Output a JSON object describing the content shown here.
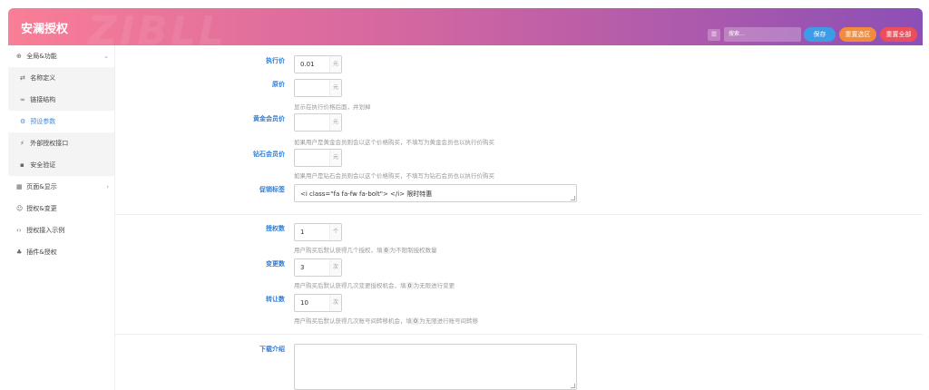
{
  "header": {
    "title": "安澜授权",
    "watermark": "ZIBLL",
    "menu_icon": "menu-icon",
    "search_placeholder": "搜索...",
    "save_label": "保存",
    "reset_section_label": "重置选区",
    "reset_all_label": "重置全部"
  },
  "sidebar": {
    "items": [
      {
        "label": "全局&功能",
        "icon": "globe-icon",
        "chevron": "⌄"
      },
      {
        "label": "页面&显示",
        "icon": "calendar-icon",
        "chevron": "›"
      },
      {
        "label": "授权&变更",
        "icon": "smile-icon"
      },
      {
        "label": "授权接入示例",
        "icon": "code-icon"
      },
      {
        "label": "插件&授权",
        "icon": "plug-icon"
      }
    ],
    "sub_items": [
      {
        "label": "名称定义",
        "icon": "retweet-icon"
      },
      {
        "label": "链接结构",
        "icon": "link-icon"
      },
      {
        "label": "预设参数",
        "icon": "cogs-icon"
      },
      {
        "label": "外部授权接口",
        "icon": "plug-icon"
      },
      {
        "label": "安全验证",
        "icon": "lock-icon"
      }
    ]
  },
  "form": {
    "exec_price": {
      "label": "执行价",
      "value": "0.01",
      "unit": "元"
    },
    "orig_price": {
      "label": "原价",
      "value": "",
      "unit": "元",
      "desc": "显示在执行价格后面，并划掉"
    },
    "gold_price": {
      "label": "黄金会员价",
      "value": "",
      "unit": "元",
      "desc": "如果用户是黄金会员则会以这个价格购买，不填写为黄金会员也以执行价购买"
    },
    "diamond_price": {
      "label": "钻石会员价",
      "value": "",
      "unit": "元",
      "desc": "如果用户是钻石会员则会以这个价格购买，不填写为钻石会员也以执行价购买"
    },
    "promo_tag": {
      "label": "促销标签",
      "value": "<i class=\"fa fa-fw fa-bolt\"> </i> 限时特惠"
    },
    "auth_count": {
      "label": "授权数",
      "value": "1",
      "unit": "个",
      "desc_a": "用户购买后默认获得几个授权，填",
      "desc_code": "0",
      "desc_b": "为不限制授权数量"
    },
    "change_count": {
      "label": "变更数",
      "value": "3",
      "unit": "次",
      "desc_a": "用户购买后默认获得几次变更授权机会，填",
      "desc_code": "0",
      "desc_b": "为无限进行变更"
    },
    "transfer_count": {
      "label": "转让数",
      "value": "10",
      "unit": "次",
      "desc_a": "用户购买后默认获得几次账号间转移机会，填",
      "desc_code": "0",
      "desc_b": "为无限进行账号间转移"
    },
    "download_intro": {
      "label": "下载介绍",
      "value": ""
    }
  }
}
